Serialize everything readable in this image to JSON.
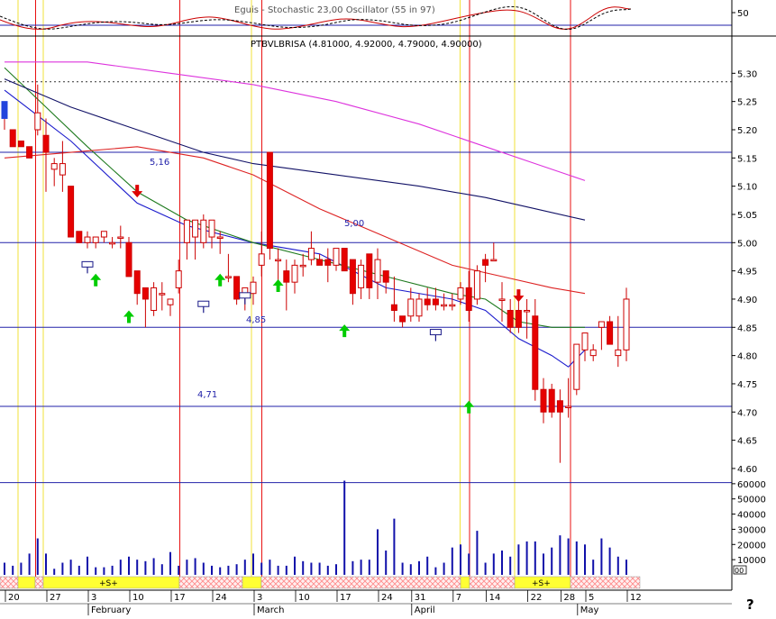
{
  "header": {
    "indicator_title": "Eguis - Stochastic 23,00 Oscillator (55 in 97)",
    "symbol_line": "PTBVLBRISA (4.81000, 4.92000, 4.79000, 4.90000)"
  },
  "colors": {
    "up": "#ffffff",
    "down": "#e60000",
    "candle_outline": "#cc0000",
    "ma_fast": "#1a1acc",
    "ma_mid": "#1e7a1e",
    "ma_red": "#dd2222",
    "ma_slow": "#111166",
    "ma_long": "#dd33dd",
    "hline": "#2222aa",
    "vline_red": "#e81010",
    "vline_yellow": "#f2e23a",
    "volume": "#1010aa",
    "signal_up": "#00cc00",
    "signal_down": "#dd0000",
    "timebar_yellow": "#ffff33",
    "timebar_hatch": "#ffbbbb"
  },
  "chart_data": {
    "type": "candlestick",
    "title": "PTBVLBRISA (4.81000, 4.92000, 4.79000, 4.90000)",
    "price_axis": {
      "ylim": [
        4.56,
        5.35
      ],
      "ticks": [
        "5.30",
        "5.25",
        "5.20",
        "5.15",
        "5.10",
        "5.05",
        "5.00",
        "4.95",
        "4.90",
        "4.85",
        "4.80",
        "4.75",
        "4.70",
        "4.65",
        "4.60"
      ]
    },
    "volume_axis": {
      "ylim": [
        0,
        70000
      ],
      "ticks": [
        "60000",
        "50000",
        "40000",
        "30000",
        "20000",
        "10000"
      ],
      "unit_marker": "00"
    },
    "oscillator_axis": {
      "ylim": [
        0,
        100
      ],
      "ticks": [
        "50"
      ]
    },
    "x_ticks": [
      {
        "i": 0,
        "label": "20"
      },
      {
        "i": 5,
        "label": "27"
      },
      {
        "i": 10,
        "label": "3"
      },
      {
        "i": 15,
        "label": "10"
      },
      {
        "i": 20,
        "label": "17"
      },
      {
        "i": 25,
        "label": "24"
      },
      {
        "i": 30,
        "label": "3"
      },
      {
        "i": 35,
        "label": "10"
      },
      {
        "i": 40,
        "label": "17"
      },
      {
        "i": 45,
        "label": "24"
      },
      {
        "i": 49,
        "label": "31"
      },
      {
        "i": 54,
        "label": "7"
      },
      {
        "i": 58,
        "label": "14"
      },
      {
        "i": 63,
        "label": "22"
      },
      {
        "i": 67,
        "label": "28"
      },
      {
        "i": 70,
        "label": "5"
      },
      {
        "i": 75,
        "label": "12"
      }
    ],
    "months": [
      {
        "i": 10,
        "label": "February"
      },
      {
        "i": 30,
        "label": "March"
      },
      {
        "i": 49,
        "label": "April"
      },
      {
        "i": 69,
        "label": "May"
      }
    ],
    "candles": [
      [
        5.22,
        5.25,
        5.2,
        5.25
      ],
      [
        5.2,
        5.2,
        5.17,
        5.17
      ],
      [
        5.18,
        5.18,
        5.17,
        5.17
      ],
      [
        5.17,
        5.17,
        5.15,
        5.15
      ],
      [
        5.2,
        5.28,
        5.19,
        5.23
      ],
      [
        5.19,
        5.22,
        5.09,
        5.16
      ],
      [
        5.13,
        5.15,
        5.1,
        5.14
      ],
      [
        5.12,
        5.18,
        5.09,
        5.14
      ],
      [
        5.1,
        5.1,
        5.01,
        5.01
      ],
      [
        5.02,
        5.02,
        5.0,
        5.0
      ],
      [
        5.0,
        5.02,
        4.99,
        5.01
      ],
      [
        5.0,
        5.01,
        4.99,
        5.01
      ],
      [
        5.01,
        5.02,
        5.0,
        5.02
      ],
      [
        5.0,
        5.01,
        4.99,
        5.0
      ],
      [
        5.01,
        5.03,
        4.99,
        5.01
      ],
      [
        5.0,
        5.01,
        4.94,
        4.94
      ],
      [
        4.95,
        4.95,
        4.89,
        4.91
      ],
      [
        4.92,
        4.92,
        4.85,
        4.9
      ],
      [
        4.88,
        4.93,
        4.87,
        4.92
      ],
      [
        4.91,
        4.93,
        4.88,
        4.91
      ],
      [
        4.89,
        4.89,
        4.87,
        4.9
      ],
      [
        4.92,
        4.97,
        4.91,
        4.95
      ],
      [
        5.0,
        5.04,
        4.97,
        5.04
      ],
      [
        5.01,
        5.04,
        4.97,
        5.04
      ],
      [
        5.0,
        5.05,
        4.99,
        5.04
      ],
      [
        5.01,
        5.04,
        4.99,
        5.04
      ],
      [
        5.01,
        5.02,
        4.98,
        5.01
      ],
      [
        4.94,
        4.98,
        4.93,
        4.94
      ],
      [
        4.94,
        4.94,
        4.89,
        4.9
      ],
      [
        4.91,
        4.91,
        4.88,
        4.92
      ],
      [
        4.91,
        4.94,
        4.89,
        4.93
      ],
      [
        4.96,
        5.02,
        4.94,
        4.98
      ],
      [
        5.16,
        5.16,
        4.97,
        4.99
      ],
      [
        4.97,
        4.99,
        4.93,
        4.97
      ],
      [
        4.95,
        4.97,
        4.88,
        4.93
      ],
      [
        4.93,
        4.97,
        4.91,
        4.96
      ],
      [
        4.96,
        4.98,
        4.94,
        4.96
      ],
      [
        4.97,
        5.02,
        4.96,
        4.99
      ],
      [
        4.97,
        4.98,
        4.96,
        4.96
      ],
      [
        4.97,
        4.99,
        4.93,
        4.96
      ],
      [
        4.96,
        4.99,
        4.95,
        4.99
      ],
      [
        4.99,
        4.99,
        4.95,
        4.95
      ],
      [
        4.97,
        4.97,
        4.89,
        4.91
      ],
      [
        4.92,
        4.97,
        4.9,
        4.96
      ],
      [
        4.98,
        4.98,
        4.9,
        4.92
      ],
      [
        4.93,
        4.99,
        4.9,
        4.97
      ],
      [
        4.95,
        4.95,
        4.91,
        4.93
      ],
      [
        4.89,
        4.94,
        4.86,
        4.88
      ],
      [
        4.87,
        4.87,
        4.85,
        4.86
      ],
      [
        4.87,
        4.92,
        4.86,
        4.9
      ],
      [
        4.87,
        4.91,
        4.86,
        4.9
      ],
      [
        4.9,
        4.92,
        4.88,
        4.89
      ],
      [
        4.9,
        4.92,
        4.88,
        4.89
      ],
      [
        4.89,
        4.91,
        4.88,
        4.89
      ],
      [
        4.89,
        4.91,
        4.88,
        4.89
      ],
      [
        4.9,
        4.93,
        4.89,
        4.92
      ],
      [
        4.92,
        4.95,
        4.86,
        4.88
      ],
      [
        4.9,
        4.96,
        4.89,
        4.95
      ],
      [
        4.97,
        4.98,
        4.93,
        4.96
      ],
      [
        4.97,
        5.0,
        4.97,
        4.97
      ],
      [
        4.9,
        4.93,
        4.86,
        4.9
      ],
      [
        4.88,
        4.9,
        4.84,
        4.85
      ],
      [
        4.88,
        4.9,
        4.84,
        4.85
      ],
      [
        4.88,
        4.9,
        4.83,
        4.88
      ],
      [
        4.87,
        4.9,
        4.72,
        4.74
      ],
      [
        4.74,
        4.76,
        4.68,
        4.7
      ],
      [
        4.74,
        4.75,
        4.69,
        4.7
      ],
      [
        4.72,
        4.74,
        4.61,
        4.7
      ],
      [
        4.71,
        4.76,
        4.69,
        4.71
      ],
      [
        4.74,
        4.82,
        4.73,
        4.82
      ],
      [
        4.81,
        4.84,
        4.79,
        4.84
      ],
      [
        4.8,
        4.82,
        4.79,
        4.81
      ],
      [
        4.85,
        4.86,
        4.81,
        4.86
      ],
      [
        4.86,
        4.87,
        4.82,
        4.82
      ],
      [
        4.8,
        4.87,
        4.78,
        4.81
      ],
      [
        4.81,
        4.92,
        4.79,
        4.9
      ]
    ],
    "moving_averages": [
      {
        "points": [
          [
            0,
            5.27
          ],
          [
            8,
            5.18
          ],
          [
            16,
            5.07
          ],
          [
            22,
            5.03
          ],
          [
            30,
            5.0
          ],
          [
            38,
            4.98
          ],
          [
            46,
            4.92
          ],
          [
            54,
            4.9
          ],
          [
            58,
            4.88
          ],
          [
            62,
            4.83
          ],
          [
            66,
            4.8
          ],
          [
            68,
            4.78
          ],
          [
            70,
            4.81
          ]
        ]
      },
      {
        "points": [
          [
            0,
            5.31
          ],
          [
            5,
            5.24
          ],
          [
            10,
            5.17
          ],
          [
            16,
            5.09
          ],
          [
            22,
            5.04
          ],
          [
            30,
            5.0
          ],
          [
            38,
            4.97
          ],
          [
            46,
            4.94
          ],
          [
            54,
            4.91
          ],
          [
            58,
            4.9
          ],
          [
            62,
            4.86
          ],
          [
            66,
            4.85
          ],
          [
            70,
            4.85
          ]
        ]
      },
      {
        "points": [
          [
            0,
            5.15
          ],
          [
            8,
            5.16
          ],
          [
            16,
            5.17
          ],
          [
            24,
            5.15
          ],
          [
            30,
            5.12
          ],
          [
            38,
            5.06
          ],
          [
            46,
            5.01
          ],
          [
            54,
            4.96
          ],
          [
            60,
            4.94
          ],
          [
            66,
            4.92
          ],
          [
            70,
            4.91
          ]
        ]
      },
      {
        "points": [
          [
            0,
            5.29
          ],
          [
            8,
            5.24
          ],
          [
            16,
            5.2
          ],
          [
            24,
            5.16
          ],
          [
            30,
            5.14
          ],
          [
            40,
            5.12
          ],
          [
            50,
            5.1
          ],
          [
            58,
            5.08
          ],
          [
            64,
            5.06
          ],
          [
            70,
            5.04
          ]
        ]
      },
      {
        "points": [
          [
            0,
            5.32
          ],
          [
            10,
            5.32
          ],
          [
            20,
            5.3
          ],
          [
            30,
            5.28
          ],
          [
            40,
            5.25
          ],
          [
            50,
            5.21
          ],
          [
            58,
            5.17
          ],
          [
            64,
            5.14
          ],
          [
            70,
            5.11
          ]
        ]
      }
    ],
    "horizontal_levels": [
      {
        "price": 5.285,
        "style": "dotted"
      },
      {
        "price": 5.16,
        "label": "5,16"
      },
      {
        "price": 5.0,
        "label": "5,00"
      },
      {
        "price": 4.85,
        "label": "4,85"
      },
      {
        "price": 4.71,
        "label": "4,71"
      },
      {
        "price": 4.575
      }
    ],
    "vertical_lines": [
      {
        "x": 20.0,
        "color": "yellow"
      },
      {
        "x": 39.5,
        "color": "red"
      },
      {
        "x": 48.0,
        "color": "yellow"
      },
      {
        "x": 199.5,
        "color": "red"
      },
      {
        "x": 279.0,
        "color": "yellow"
      },
      {
        "x": 290.5,
        "color": "red"
      },
      {
        "x": 510.5,
        "color": "yellow"
      },
      {
        "x": 521.0,
        "color": "red"
      },
      {
        "x": 571.0,
        "color": "yellow"
      },
      {
        "x": 633.0,
        "color": "red"
      }
    ],
    "volumes": [
      8,
      6,
      8,
      14,
      24,
      14,
      4,
      8,
      10,
      6,
      12,
      5,
      5,
      6,
      10,
      12,
      10,
      9,
      11,
      7,
      15,
      6,
      10,
      11,
      8,
      6,
      5,
      6,
      7,
      10,
      14,
      8,
      10,
      6,
      6,
      12,
      9,
      8,
      8,
      6,
      7,
      8,
      9,
      10,
      10,
      12,
      16,
      6,
      8,
      7,
      9,
      12,
      5,
      8,
      18,
      20,
      14,
      7,
      8,
      14,
      16,
      12,
      20,
      22,
      22,
      14,
      18,
      26,
      24,
      22,
      20,
      10,
      24,
      18,
      12,
      10
    ],
    "volume_spikes": [
      {
        "i": 41,
        "value": 62000
      },
      {
        "i": 45,
        "value": 30000
      },
      {
        "i": 47,
        "value": 37000
      },
      {
        "i": 57,
        "value": 29000
      }
    ],
    "signals_up": [
      {
        "i": 11,
        "price": 4.945
      },
      {
        "i": 15,
        "price": 4.88
      },
      {
        "i": 26,
        "price": 4.945
      },
      {
        "i": 33,
        "price": 4.935
      },
      {
        "i": 41,
        "price": 4.855
      },
      {
        "i": 56,
        "price": 4.72
      }
    ],
    "signals_down": [
      {
        "i": 16,
        "price": 5.08
      },
      {
        "i": 62,
        "price": 4.895
      }
    ],
    "exit_markers": [
      {
        "i": 10,
        "price": 4.96
      },
      {
        "i": 24,
        "price": 4.89
      },
      {
        "i": 29,
        "price": 4.905
      },
      {
        "i": 52,
        "price": 4.84
      }
    ],
    "timebar": {
      "labels": [
        "+S+",
        "+S+"
      ]
    },
    "help_glyph": "?"
  }
}
